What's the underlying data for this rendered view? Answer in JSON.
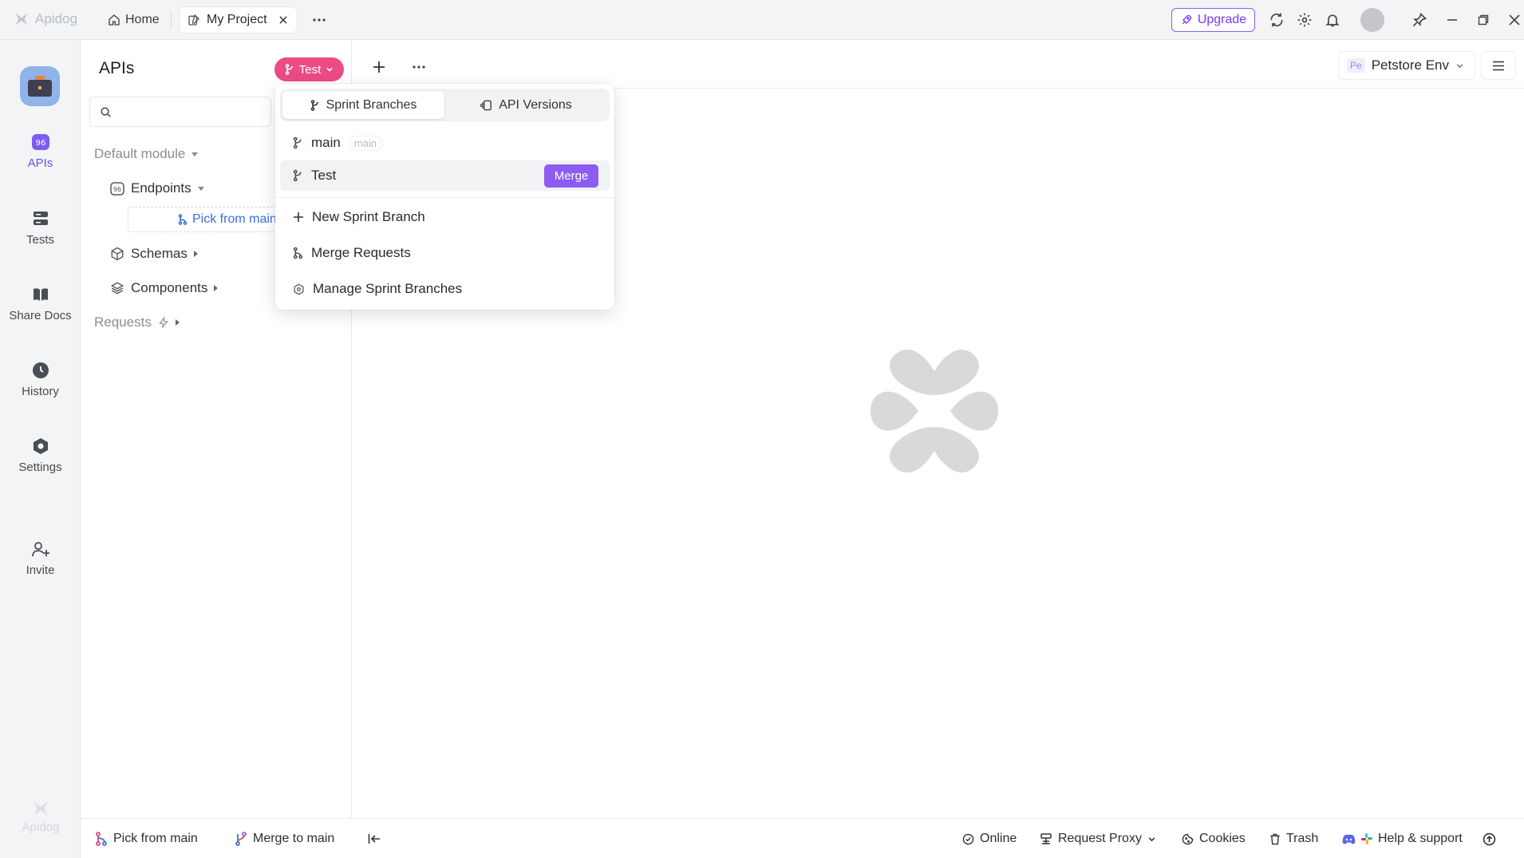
{
  "titlebar": {
    "brand": "Apidog",
    "home_tab": "Home",
    "project_tab": "My Project",
    "upgrade_label": "Upgrade"
  },
  "rail": {
    "items": [
      {
        "label": "APIs",
        "icon": "api-icon"
      },
      {
        "label": "Tests",
        "icon": "tests-icon"
      },
      {
        "label": "Share Docs",
        "icon": "book-icon"
      },
      {
        "label": "History",
        "icon": "clock-icon"
      },
      {
        "label": "Settings",
        "icon": "settings-icon"
      },
      {
        "label": "Invite",
        "icon": "add-user-icon"
      }
    ],
    "footer_logo": "Apidog"
  },
  "sidebar": {
    "title": "APIs",
    "branch": "Test",
    "search_placeholder": "",
    "tree": {
      "default_module": "Default module",
      "endpoints": "Endpoints",
      "pick_from_main": "Pick from main",
      "schemas": "Schemas",
      "components": "Components",
      "requests": "Requests"
    }
  },
  "main": {
    "env_badge": "Pe",
    "env_name": "Petstore Env"
  },
  "dropdown": {
    "tabs": [
      "Sprint Branches",
      "API Versions"
    ],
    "active_tab": "Sprint Branches",
    "branches": [
      {
        "name": "main",
        "tag": "main"
      },
      {
        "name": "Test",
        "action": "Merge"
      }
    ],
    "actions": [
      {
        "label": "New Sprint Branch",
        "icon": "plus-icon"
      },
      {
        "label": "Merge Requests",
        "icon": "branch-icon"
      },
      {
        "label": "Manage Sprint Branches",
        "icon": "gear-icon"
      }
    ]
  },
  "bottombar": {
    "pick_from_main": "Pick from main",
    "merge_to_main": "Merge to main",
    "online": "Online",
    "request_proxy": "Request Proxy",
    "cookies": "Cookies",
    "trash": "Trash",
    "help": "Help & support"
  },
  "colors": {
    "accent": "#8c5cf2",
    "branch_pill": "#ec4b86",
    "link": "#3b6fd9"
  }
}
